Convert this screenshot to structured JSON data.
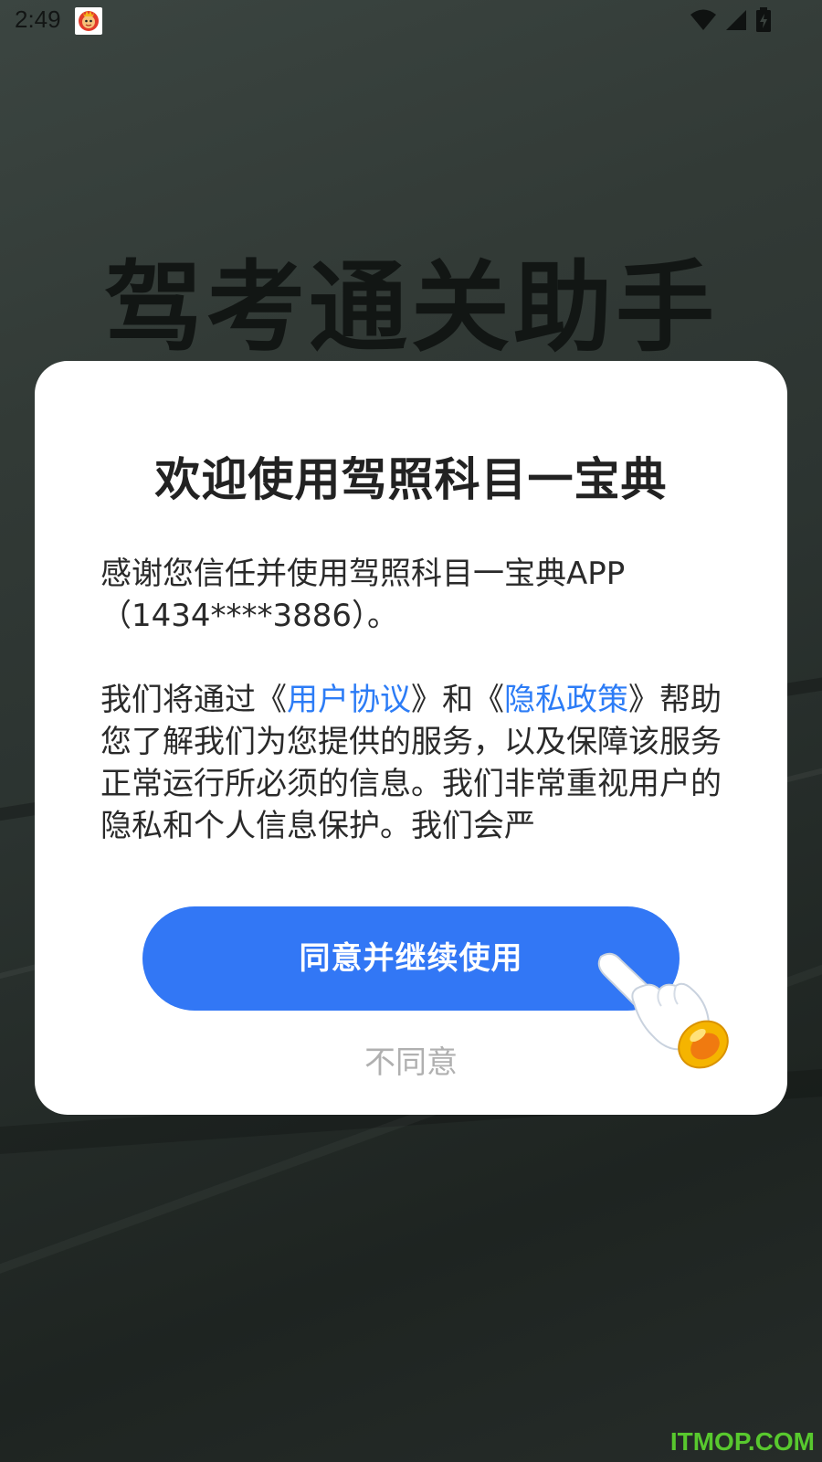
{
  "status_bar": {
    "time": "2:49",
    "app_icon": "lion-mascot-icon",
    "wifi_icon": "wifi-icon",
    "signal_icon": "signal-icon",
    "battery_icon": "battery-charging-icon"
  },
  "background": {
    "title": "驾考通关助手"
  },
  "dialog": {
    "title": "欢迎使用驾照科目一宝典",
    "para1_line1": "感谢您信任并使用驾照科目一宝典APP",
    "para1_line2": "（1434****3886）。",
    "para2_pre": "我们将通过《",
    "link_user_agreement": "用户协议",
    "para2_mid": "》和《",
    "link_privacy_policy": "隐私政策",
    "para2_post": "》帮助您了解我们为您提供的服务，以及保障该服务正常运行所必须的信息。我们非常重视用户的隐私和个人信息保护。我们会严",
    "agree_label": "同意并继续使用",
    "disagree_label": "不同意",
    "pointer_icon": "hand-pointer-icon"
  },
  "watermark": "ITMOP.COM",
  "colors": {
    "primary": "#3277f5",
    "link": "#2c7cf6",
    "watermark": "#58c82e"
  }
}
